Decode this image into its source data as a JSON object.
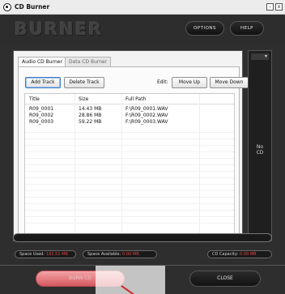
{
  "window": {
    "title": "CD Burner",
    "minimize_label": "–",
    "close_label": "x"
  },
  "header": {
    "brand": "BURNER",
    "options_label": "OPTIONS",
    "help_label": "HELP"
  },
  "tabs": [
    {
      "label": "Audio CD Burner"
    },
    {
      "label": "Data CD Burner"
    }
  ],
  "toolbar": {
    "add_track_label": "Add Track",
    "delete_track_label": "Delete Track",
    "edit_label": "Edit:",
    "move_up_label": "Move Up",
    "move_down_label": "Move Down"
  },
  "table": {
    "columns": [
      "Title",
      "Size",
      "Full Path"
    ],
    "rows": [
      {
        "title": "R09_0001",
        "size": "14.43 MB",
        "path": "F:\\R09_0001.WAV"
      },
      {
        "title": "R09_0002",
        "size": "28.86 MB",
        "path": "F:\\R09_0002.WAV"
      },
      {
        "title": "R09_0003",
        "size": "59.22 MB",
        "path": "F:\\R09_0003.WAV"
      }
    ]
  },
  "side": {
    "dropdown_icon": "chevron-down-icon",
    "status_line1": "No",
    "status_line2": "CD"
  },
  "status": {
    "space_used_label": "Space Used:",
    "space_used_value": "102.51 MB",
    "space_available_label": "Space Available:",
    "space_available_value": "0.00 MB",
    "capacity_label": "CD Capacity:",
    "capacity_value": "0.00 MB"
  },
  "footer": {
    "burn_label": "BURN CD",
    "close_label": "CLOSE"
  },
  "colors": {
    "accent_red": "#e0413a",
    "burn_button": "#e07178",
    "dark_panel": "#2e2e2e"
  }
}
